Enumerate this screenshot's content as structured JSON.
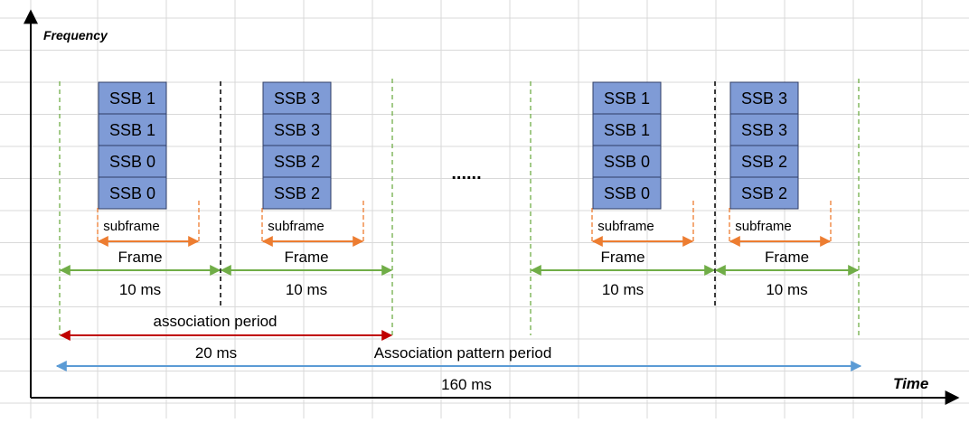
{
  "axes": {
    "y_label": "Frequency",
    "x_label": "Time"
  },
  "ellipsis": "......",
  "groups": [
    {
      "blocks": [
        {
          "ssb": [
            "SSB 1",
            "SSB 1",
            "SSB 0",
            "SSB 0"
          ],
          "subframe": "subframe",
          "frame": "Frame",
          "duration": "10 ms"
        },
        {
          "ssb": [
            "SSB 3",
            "SSB 3",
            "SSB 2",
            "SSB 2"
          ],
          "subframe": "subframe",
          "frame": "Frame",
          "duration": "10 ms"
        }
      ]
    },
    {
      "blocks": [
        {
          "ssb": [
            "SSB 1",
            "SSB 1",
            "SSB 0",
            "SSB 0"
          ],
          "subframe": "subframe",
          "frame": "Frame",
          "duration": "10 ms"
        },
        {
          "ssb": [
            "SSB 3",
            "SSB 3",
            "SSB 2",
            "SSB 2"
          ],
          "subframe": "subframe",
          "frame": "Frame",
          "duration": "10 ms"
        }
      ]
    }
  ],
  "association_period": {
    "label": "association period",
    "duration": "20 ms"
  },
  "association_pattern_period": {
    "label": "Association pattern period",
    "duration": "160 ms"
  },
  "colors": {
    "ssb_fill": "#7f9bd6",
    "ssb_stroke": "#2f3e66",
    "grid": "#d9d9d9",
    "subframe_arrow": "#ed7d31",
    "frame_arrow": "#70ad47",
    "frame_boundary": "#70ad47",
    "frame_divider": "#000000",
    "association_arrow": "#c00000",
    "pattern_arrow": "#5b9bd5",
    "axis": "#000000"
  }
}
